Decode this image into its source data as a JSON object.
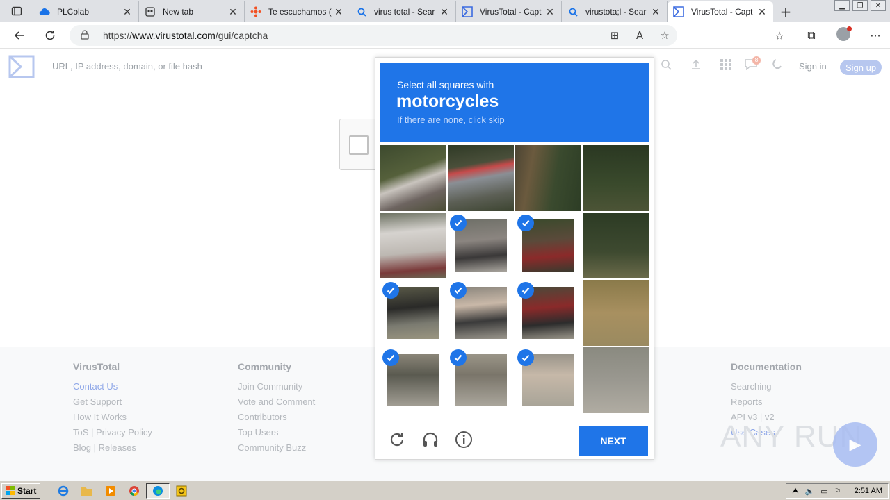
{
  "browser": {
    "tabs": [
      {
        "title": "PLColab",
        "icon": "cloud-icon"
      },
      {
        "title": "New tab",
        "icon": "newtab-icon"
      },
      {
        "title": "Te escuchamos (",
        "icon": "feedback-icon"
      },
      {
        "title": "virus total - Sear",
        "icon": "search-icon"
      },
      {
        "title": "VirusTotal - Capt",
        "icon": "virustotal-icon"
      },
      {
        "title": "virustota;l - Sear",
        "icon": "search-icon"
      },
      {
        "title": "VirusTotal - Capt",
        "icon": "virustotal-icon",
        "active": true
      }
    ],
    "url_prefix": "https://",
    "url_domain": "www.virustotal.com",
    "url_path": "/gui/captcha"
  },
  "vt": {
    "search_placeholder": "URL, IP address, domain, or file hash",
    "notification_count": "8",
    "sign_in": "Sign in",
    "sign_up": "Sign up"
  },
  "footer": {
    "columns": [
      {
        "heading": "VirusTotal",
        "links": [
          "Contact Us",
          "Get Support",
          "How It Works",
          "ToS | Privacy Policy",
          "Blog | Releases"
        ]
      },
      {
        "heading": "Community",
        "links": [
          "Join Community",
          "Vote and Comment",
          "Contributors",
          "Top Users",
          "Community Buzz"
        ]
      },
      {
        "heading": "Documentation",
        "links": [
          "Searching",
          "Reports",
          "API v3 | v2",
          "Use Cases"
        ]
      }
    ],
    "watermark": "ANY RUN"
  },
  "captcha": {
    "prompt_line1": "Select all squares with",
    "prompt_target": "motorcycles",
    "prompt_line3": "If there are none, click skip",
    "next_label": "NEXT",
    "selected": [
      5,
      6,
      8,
      9,
      10,
      12,
      13,
      14
    ]
  },
  "taskbar": {
    "start_label": "Start",
    "clock": "2:51 AM"
  },
  "colors": {
    "accent": "#1f75e8",
    "vt_blue": "#3b6be0"
  }
}
